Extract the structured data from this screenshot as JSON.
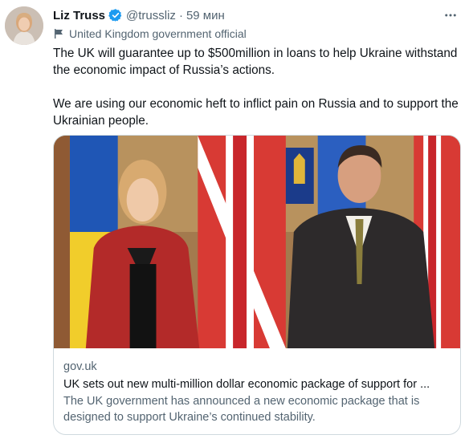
{
  "author": {
    "name": "Liz Truss",
    "handle": "@trussliz",
    "separator": "·",
    "time": "59 мин",
    "label": "United Kingdom government official"
  },
  "tweet": {
    "paragraph1": "The UK will guarantee up to $500million in loans to help Ukraine withstand the economic impact of Russia’s actions.",
    "paragraph2": "We are using our economic heft to inflict pain on Russia and to support the Ukrainian people."
  },
  "card": {
    "domain": "gov.uk",
    "title": "UK sets out new multi-million dollar economic package of support for ...",
    "description": "The UK government has announced a new economic package that is designed to support Ukraine’s continued stability."
  },
  "colors": {
    "text": "#0f1419",
    "secondary": "#536471",
    "verified": "#1d9bf0",
    "border": "#cfd9de"
  },
  "icons": [
    "verified-badge-icon",
    "more-icon",
    "government-flag-icon"
  ]
}
